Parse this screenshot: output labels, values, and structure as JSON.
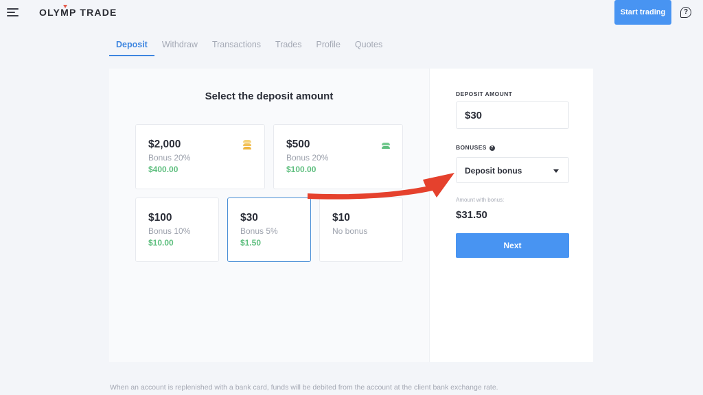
{
  "header": {
    "logo_text_a": "OLY",
    "logo_text_m": "M",
    "logo_text_b": "P TRADE",
    "start_trading_label": "Start trading",
    "help_glyph": "?",
    "icons": {
      "menu": "hamburger-menu-icon",
      "help": "help-question-icon"
    }
  },
  "tabs": [
    {
      "label": "Deposit",
      "active": true
    },
    {
      "label": "Withdraw",
      "active": false
    },
    {
      "label": "Transactions",
      "active": false
    },
    {
      "label": "Trades",
      "active": false
    },
    {
      "label": "Profile",
      "active": false
    },
    {
      "label": "Quotes",
      "active": false
    }
  ],
  "deposit": {
    "title": "Select the deposit amount",
    "options": [
      {
        "amount": "$2,000",
        "bonus_text": "Bonus 20%",
        "bonus_value": "$400.00",
        "rank_icon": "gold-rank-icon",
        "rank_color": "#f2c158",
        "selected": false
      },
      {
        "amount": "$500",
        "bonus_text": "Bonus 20%",
        "bonus_value": "$100.00",
        "rank_icon": "green-rank-icon",
        "rank_color": "#5fbf7f",
        "selected": false
      },
      {
        "amount": "$100",
        "bonus_text": "Bonus 10%",
        "bonus_value": "$10.00",
        "selected": false
      },
      {
        "amount": "$30",
        "bonus_text": "Bonus 5%",
        "bonus_value": "$1.50",
        "selected": true
      },
      {
        "amount": "$10",
        "bonus_text": "No bonus",
        "bonus_value": "",
        "selected": false
      }
    ]
  },
  "sidebar": {
    "deposit_amount_label": "DEPOSIT AMOUNT",
    "deposit_amount_value": "$30",
    "bonuses_label": "BONUSES",
    "bonuses_info_glyph": "?",
    "bonus_selected": "Deposit bonus",
    "amount_with_bonus_label": "Amount with bonus:",
    "amount_with_bonus_value": "$31.50",
    "next_label": "Next"
  },
  "footnote": "When an account is replenished with a bank card, funds will be debited from the account at the client bank exchange rate.",
  "colors": {
    "accent": "#4894f2",
    "tab_active": "#3e86e0",
    "bonus_green": "#5fbf7f",
    "annotation_arrow": "#e5412d",
    "page_bg": "#f3f5f9"
  }
}
